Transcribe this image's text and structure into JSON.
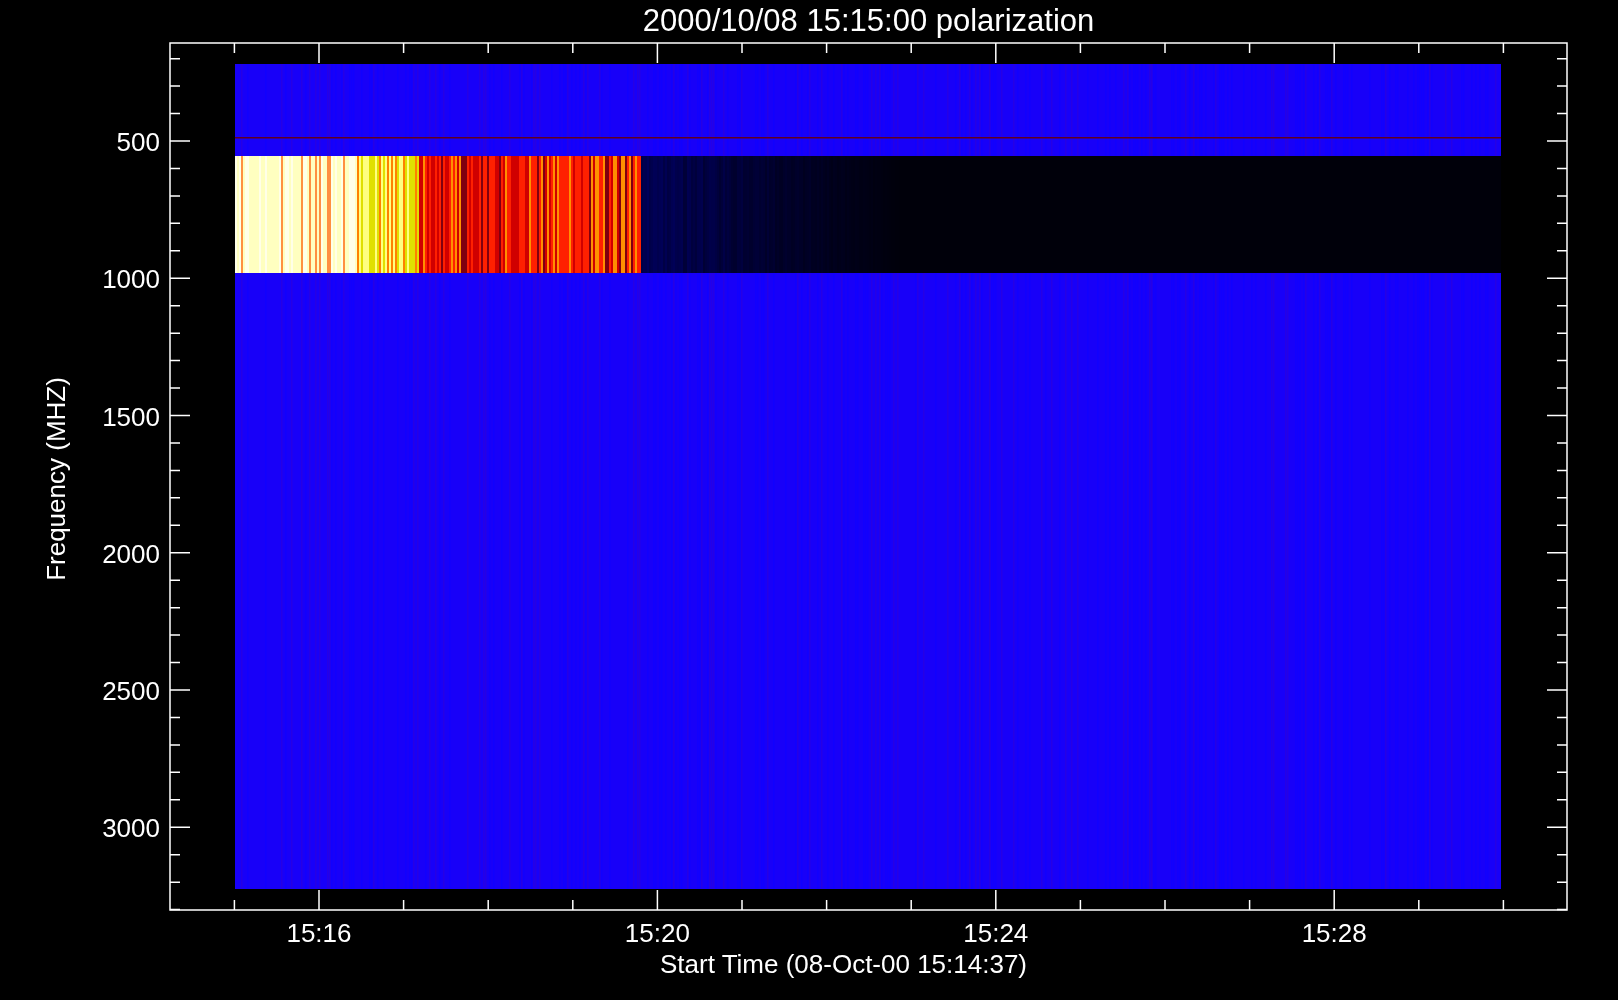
{
  "title": "2000/10/08 15:15:00 polarization",
  "ylabel": "Frequency (MHZ)",
  "xlabel": "Start Time (08-Oct-00 15:14:37)",
  "yticks": [
    "500",
    "1000",
    "1500",
    "2000",
    "2500",
    "3000"
  ],
  "xticks": [
    "15:16",
    "15:20",
    "15:24",
    "15:28"
  ]
}
